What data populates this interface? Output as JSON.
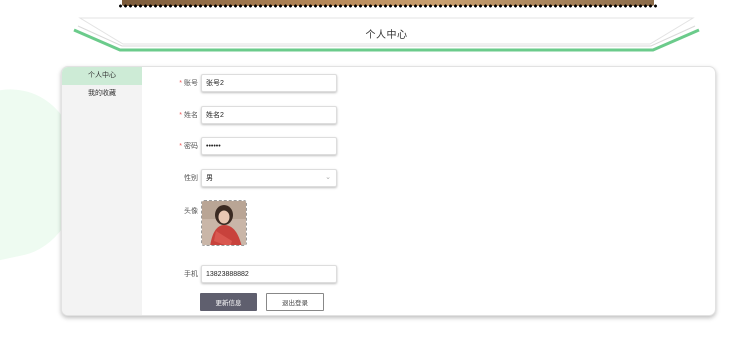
{
  "header": {
    "title": "个人中心"
  },
  "sidebar": {
    "items": [
      {
        "label": "个人中心",
        "active": true
      },
      {
        "label": "我的收藏",
        "active": false
      }
    ]
  },
  "form": {
    "account": {
      "label": "账号",
      "value": "张号2",
      "required": true
    },
    "name": {
      "label": "姓名",
      "value": "姓名2",
      "required": true
    },
    "password": {
      "label": "密码",
      "value": "123456",
      "required": true
    },
    "gender": {
      "label": "性别",
      "value": "男"
    },
    "avatar": {
      "label": "头像"
    },
    "phone": {
      "label": "手机",
      "value": "13823888882"
    }
  },
  "actions": {
    "update_label": "更新信息",
    "logout_label": "退出登录"
  },
  "colors": {
    "accent_green": "#6bcb8b",
    "sidebar_active": "#cdebd6",
    "primary_button": "#5f5f6e"
  }
}
